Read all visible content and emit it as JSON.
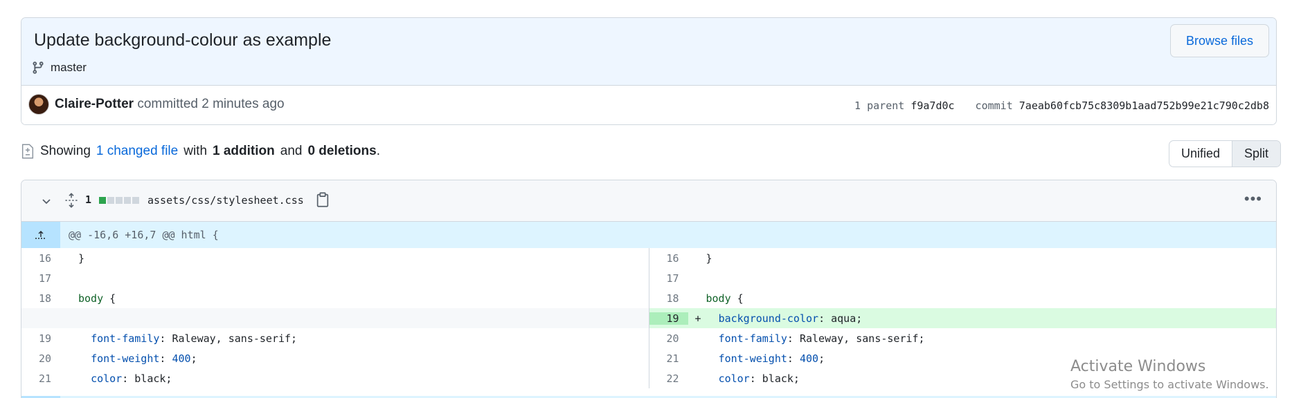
{
  "commit": {
    "title": "Update background-colour as example",
    "branch": "master",
    "browse_files_label": "Browse files",
    "author": "Claire-Potter",
    "committed_text": "committed 2 minutes ago",
    "parent_label": "1 parent",
    "parent_sha": "f9a7d0c",
    "commit_label": "commit",
    "commit_sha": "7aeab60fcb75c8309b1aad752b99e21c790c2db8"
  },
  "summary": {
    "showing": "Showing",
    "changed_files": "1 changed file",
    "with": "with",
    "additions": "1 addition",
    "and": "and",
    "deletions": "0 deletions",
    "period": "."
  },
  "view_toggle": {
    "unified": "Unified",
    "split": "Split",
    "selected": "Split"
  },
  "file": {
    "change_count": "1",
    "diffstat": [
      "add",
      "neutral",
      "neutral",
      "neutral",
      "neutral"
    ],
    "path": "assets/css/stylesheet.css",
    "hunk_header": "@@ -16,6 +16,7 @@ html {"
  },
  "diff": {
    "left": [
      {
        "num": "16",
        "code": "}",
        "type": "context"
      },
      {
        "num": "17",
        "code": "",
        "type": "context"
      },
      {
        "num": "18",
        "code": "body {",
        "type": "context"
      },
      {
        "num": "",
        "code": "",
        "type": "empty"
      },
      {
        "num": "19",
        "code": "  font-family: Raleway, sans-serif;",
        "type": "context"
      },
      {
        "num": "20",
        "code": "  font-weight: 400;",
        "type": "context"
      },
      {
        "num": "21",
        "code": "  color: black;",
        "type": "context"
      }
    ],
    "right": [
      {
        "num": "16",
        "code": "}",
        "type": "context"
      },
      {
        "num": "17",
        "code": "",
        "type": "context"
      },
      {
        "num": "18",
        "code": "body {",
        "type": "context"
      },
      {
        "num": "19",
        "code": "  background-color: aqua;",
        "type": "added",
        "marker": "+"
      },
      {
        "num": "20",
        "code": "  font-family: Raleway, sans-serif;",
        "type": "context"
      },
      {
        "num": "21",
        "code": "  font-weight: 400;",
        "type": "context"
      },
      {
        "num": "22",
        "code": "  color: black;",
        "type": "context"
      }
    ]
  },
  "watermark": {
    "title": "Activate Windows",
    "subtitle": "Go to Settings to activate Windows."
  },
  "colors": {
    "accent": "#0969da",
    "added_bg": "#dafbe1",
    "added_num_bg": "#aceebb",
    "hunk_bg": "#ddf4ff",
    "diffstat_add": "#2da44e"
  },
  "icons": [
    "git-branch-icon",
    "file-diff-icon",
    "chevron-down-icon",
    "unfold-icon",
    "copy-icon",
    "kebab-horizontal-icon",
    "expand-up-icon",
    "expand-icon"
  ]
}
